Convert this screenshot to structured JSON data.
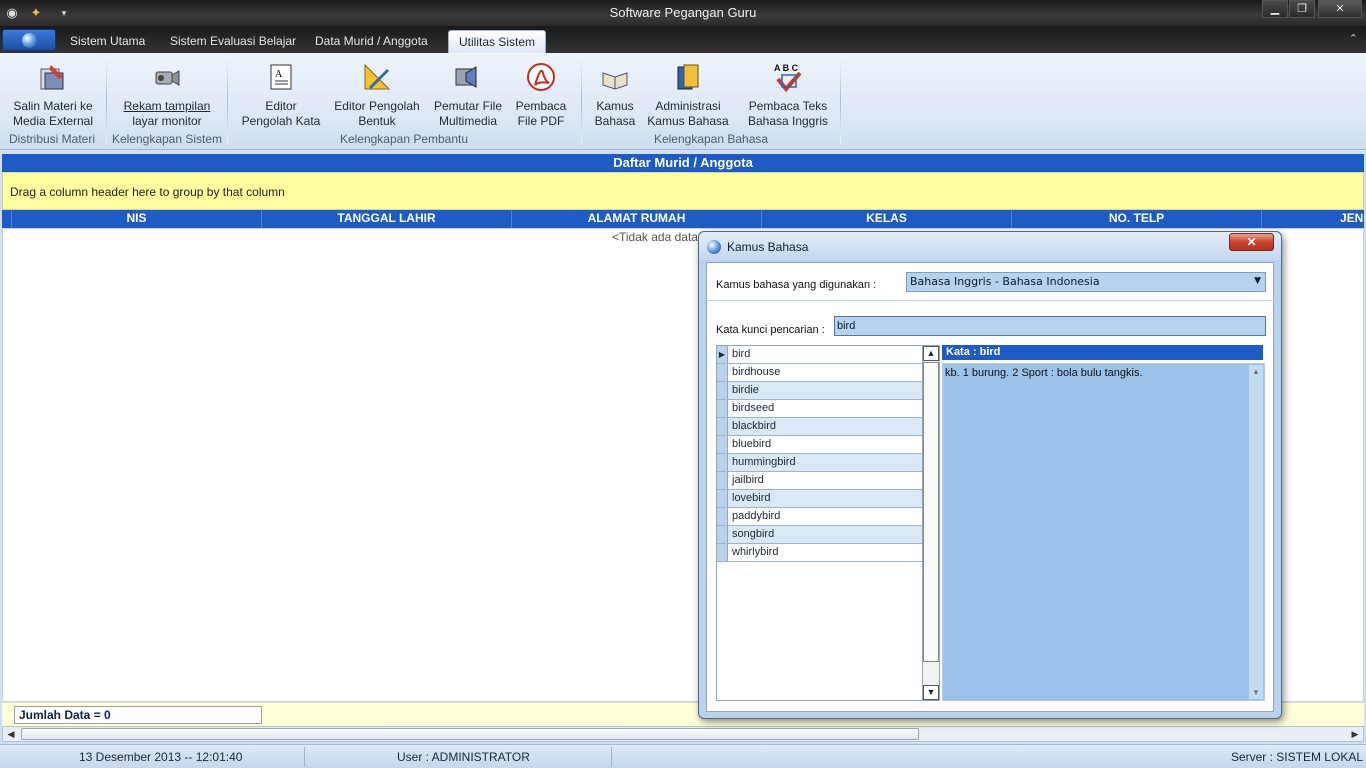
{
  "window": {
    "title": "Software Pegangan Guru",
    "minimize_label": "▁",
    "maximize_label": "❐",
    "close_label": "✕"
  },
  "ribbon": {
    "tabs": [
      {
        "label": "Sistem Utama",
        "active": false
      },
      {
        "label": "Sistem Evaluasi Belajar",
        "active": false
      },
      {
        "label": "Data Murid / Anggota",
        "active": false
      },
      {
        "label": "Utilitas Sistem",
        "active": true
      }
    ],
    "buttons": [
      {
        "line1": "Salin Materi ke",
        "line2": "Media External",
        "icon": "copy-media-icon"
      },
      {
        "line1": "Rekam tampilan",
        "line2": "layar monitor",
        "icon": "video-camera-icon"
      },
      {
        "line1": "Editor",
        "line2": "Pengolah Kata",
        "icon": "text-document-icon"
      },
      {
        "line1": "Editor Pengolah",
        "line2": "Bentuk",
        "icon": "drawing-tools-icon"
      },
      {
        "line1": "Pemutar File",
        "line2": "Multimedia",
        "icon": "speaker-film-icon"
      },
      {
        "line1": "Pembaca",
        "line2": "File PDF",
        "icon": "pdf-reader-icon"
      },
      {
        "line1": "Kamus",
        "line2": "Bahasa",
        "icon": "dictionary-book-icon"
      },
      {
        "line1": "Administrasi",
        "line2": "Kamus Bahasa",
        "icon": "books-admin-icon"
      },
      {
        "line1": "Pembaca Teks",
        "line2": "Bahasa Inggris",
        "icon": "abc-check-icon"
      }
    ],
    "groups": [
      "Distribusi Materi",
      "Kelengkapan Sistem",
      "Kelengkapan Pembantu",
      "Kelengkapan Bahasa"
    ]
  },
  "grid": {
    "caption": "Daftar Murid / Anggota",
    "group_panel_hint": "Drag a column header here to group by that column",
    "columns": [
      "NIS",
      "TANGGAL LAHIR",
      "ALAMAT RUMAH",
      "KELAS",
      "NO. TELP",
      "JENI"
    ],
    "empty_text": "<Tidak ada data g",
    "footer_count": "Jumlah Data = 0"
  },
  "statusbar": {
    "datetime": "13 Desember 2013 -- 12:01:40",
    "user": "User : ADMINISTRATOR",
    "server": "Server : SISTEM LOKAL"
  },
  "dialog": {
    "title": "Kamus Bahasa",
    "close_label": "✕",
    "language_label": "Kamus bahasa yang digunakan :",
    "language_value": "Bahasa Inggris - Bahasa Indonesia",
    "search_label": "Kata kunci pencarian :",
    "search_value": "bird",
    "words": [
      "bird",
      "birdhouse",
      "birdie",
      "birdseed",
      "blackbird",
      "bluebird",
      "hummingbird",
      "jailbird",
      "lovebird",
      "paddybird",
      "songbird",
      "whirlybird"
    ],
    "selected_index": 0,
    "meaning_title": "Kata : bird",
    "meaning_text": "kb. 1 burung. 2 Sport : bola bulu tangkis."
  }
}
